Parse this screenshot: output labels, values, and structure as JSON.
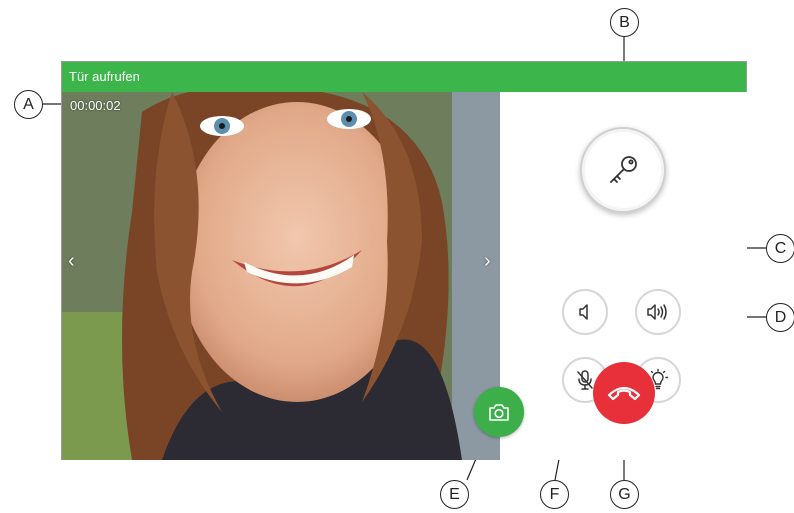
{
  "window": {
    "title": "Tür aufrufen"
  },
  "video": {
    "timer": "00:00:02",
    "prev_glyph": "‹",
    "next_glyph": "›"
  },
  "icons": {
    "door_open": "key-icon",
    "volume_down": "speaker-quiet-icon",
    "volume_up": "speaker-loud-icon",
    "mute": "microphone-muted-icon",
    "light": "light-bulb-icon",
    "snapshot": "camera-icon",
    "hangup": "phone-hangup-icon"
  },
  "colors": {
    "titlebar": "#3cb54a",
    "hangup": "#e8303a",
    "snapshot": "#3cae4a"
  },
  "callouts": {
    "A": "A",
    "B": "B",
    "C": "C",
    "D": "D",
    "E": "E",
    "F": "F",
    "G": "G"
  }
}
